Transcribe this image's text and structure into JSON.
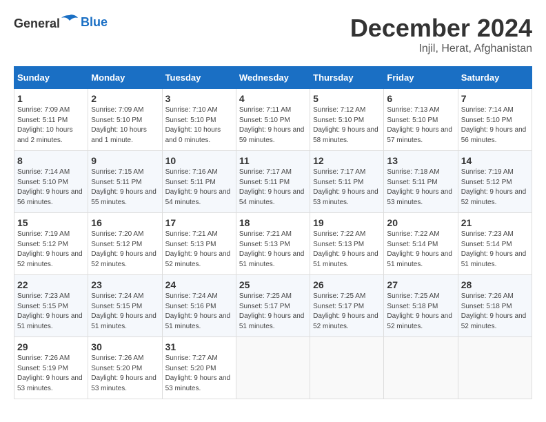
{
  "header": {
    "logo_general": "General",
    "logo_blue": "Blue",
    "month": "December 2024",
    "location": "Injil, Herat, Afghanistan"
  },
  "columns": [
    "Sunday",
    "Monday",
    "Tuesday",
    "Wednesday",
    "Thursday",
    "Friday",
    "Saturday"
  ],
  "weeks": [
    [
      {
        "day": "1",
        "sunrise": "7:09 AM",
        "sunset": "5:11 PM",
        "daylight": "10 hours and 2 minutes."
      },
      {
        "day": "2",
        "sunrise": "7:09 AM",
        "sunset": "5:10 PM",
        "daylight": "10 hours and 1 minute."
      },
      {
        "day": "3",
        "sunrise": "7:10 AM",
        "sunset": "5:10 PM",
        "daylight": "10 hours and 0 minutes."
      },
      {
        "day": "4",
        "sunrise": "7:11 AM",
        "sunset": "5:10 PM",
        "daylight": "9 hours and 59 minutes."
      },
      {
        "day": "5",
        "sunrise": "7:12 AM",
        "sunset": "5:10 PM",
        "daylight": "9 hours and 58 minutes."
      },
      {
        "day": "6",
        "sunrise": "7:13 AM",
        "sunset": "5:10 PM",
        "daylight": "9 hours and 57 minutes."
      },
      {
        "day": "7",
        "sunrise": "7:14 AM",
        "sunset": "5:10 PM",
        "daylight": "9 hours and 56 minutes."
      }
    ],
    [
      {
        "day": "8",
        "sunrise": "7:14 AM",
        "sunset": "5:10 PM",
        "daylight": "9 hours and 56 minutes."
      },
      {
        "day": "9",
        "sunrise": "7:15 AM",
        "sunset": "5:11 PM",
        "daylight": "9 hours and 55 minutes."
      },
      {
        "day": "10",
        "sunrise": "7:16 AM",
        "sunset": "5:11 PM",
        "daylight": "9 hours and 54 minutes."
      },
      {
        "day": "11",
        "sunrise": "7:17 AM",
        "sunset": "5:11 PM",
        "daylight": "9 hours and 54 minutes."
      },
      {
        "day": "12",
        "sunrise": "7:17 AM",
        "sunset": "5:11 PM",
        "daylight": "9 hours and 53 minutes."
      },
      {
        "day": "13",
        "sunrise": "7:18 AM",
        "sunset": "5:11 PM",
        "daylight": "9 hours and 53 minutes."
      },
      {
        "day": "14",
        "sunrise": "7:19 AM",
        "sunset": "5:12 PM",
        "daylight": "9 hours and 52 minutes."
      }
    ],
    [
      {
        "day": "15",
        "sunrise": "7:19 AM",
        "sunset": "5:12 PM",
        "daylight": "9 hours and 52 minutes."
      },
      {
        "day": "16",
        "sunrise": "7:20 AM",
        "sunset": "5:12 PM",
        "daylight": "9 hours and 52 minutes."
      },
      {
        "day": "17",
        "sunrise": "7:21 AM",
        "sunset": "5:13 PM",
        "daylight": "9 hours and 52 minutes."
      },
      {
        "day": "18",
        "sunrise": "7:21 AM",
        "sunset": "5:13 PM",
        "daylight": "9 hours and 51 minutes."
      },
      {
        "day": "19",
        "sunrise": "7:22 AM",
        "sunset": "5:13 PM",
        "daylight": "9 hours and 51 minutes."
      },
      {
        "day": "20",
        "sunrise": "7:22 AM",
        "sunset": "5:14 PM",
        "daylight": "9 hours and 51 minutes."
      },
      {
        "day": "21",
        "sunrise": "7:23 AM",
        "sunset": "5:14 PM",
        "daylight": "9 hours and 51 minutes."
      }
    ],
    [
      {
        "day": "22",
        "sunrise": "7:23 AM",
        "sunset": "5:15 PM",
        "daylight": "9 hours and 51 minutes."
      },
      {
        "day": "23",
        "sunrise": "7:24 AM",
        "sunset": "5:15 PM",
        "daylight": "9 hours and 51 minutes."
      },
      {
        "day": "24",
        "sunrise": "7:24 AM",
        "sunset": "5:16 PM",
        "daylight": "9 hours and 51 minutes."
      },
      {
        "day": "25",
        "sunrise": "7:25 AM",
        "sunset": "5:17 PM",
        "daylight": "9 hours and 51 minutes."
      },
      {
        "day": "26",
        "sunrise": "7:25 AM",
        "sunset": "5:17 PM",
        "daylight": "9 hours and 52 minutes."
      },
      {
        "day": "27",
        "sunrise": "7:25 AM",
        "sunset": "5:18 PM",
        "daylight": "9 hours and 52 minutes."
      },
      {
        "day": "28",
        "sunrise": "7:26 AM",
        "sunset": "5:18 PM",
        "daylight": "9 hours and 52 minutes."
      }
    ],
    [
      {
        "day": "29",
        "sunrise": "7:26 AM",
        "sunset": "5:19 PM",
        "daylight": "9 hours and 53 minutes."
      },
      {
        "day": "30",
        "sunrise": "7:26 AM",
        "sunset": "5:20 PM",
        "daylight": "9 hours and 53 minutes."
      },
      {
        "day": "31",
        "sunrise": "7:27 AM",
        "sunset": "5:20 PM",
        "daylight": "9 hours and 53 minutes."
      },
      null,
      null,
      null,
      null
    ]
  ]
}
